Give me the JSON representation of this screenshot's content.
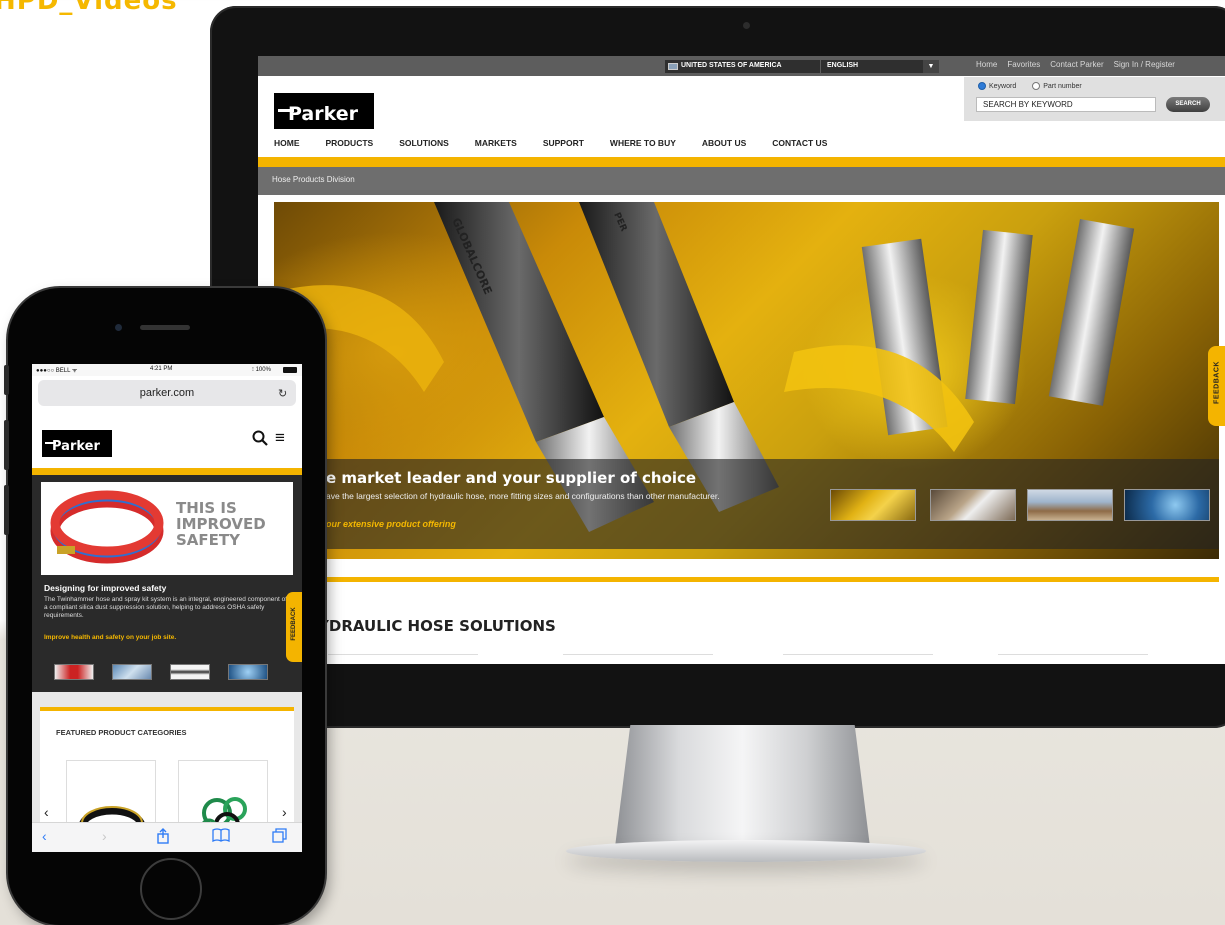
{
  "corner_title": "HPD_Videos",
  "desktop": {
    "country": "UNITED STATES OF AMERICA",
    "language": "ENGLISH",
    "top_links": [
      "Home",
      "Favorites",
      "Contact Parker",
      "Sign In / Register"
    ],
    "search": {
      "option_keyword": "Keyword",
      "option_part": "Part number",
      "value": "SEARCH BY KEYWORD",
      "button": "SEARCH"
    },
    "logo": "Parker",
    "nav": [
      "HOME",
      "PRODUCTS",
      "SOLUTIONS",
      "MARKETS",
      "SUPPORT",
      "WHERE TO BUY",
      "ABOUT US",
      "CONTACT US"
    ],
    "breadcrumb": "Hose Products Division",
    "hero": {
      "heading": "e market leader and your supplier of choice",
      "text": "ave the largest selection of hydraulic hose, more fitting sizes and configurations than other manufacturer.",
      "link": "our extensive product offering",
      "hose_label_1": "GLOBALCORE",
      "hose_label_2": "PER"
    },
    "feedback": "FEEDBACK",
    "section_title": "YDRAULIC HOSE SOLUTIONS"
  },
  "phone": {
    "status_left": "●●●○○ BELL ᯤ",
    "status_time": "4:21 PM",
    "status_right": "⁝ 100%",
    "url": "parker.com",
    "logo": "Parker",
    "banner_title_1": "THIS IS",
    "banner_title_2": "IMPROVED",
    "banner_title_3": "SAFETY",
    "heading": "Designing for improved safety",
    "text": "The Twinhammer hose and spray kit system is an integral, engineered component of a compliant silica dust suppression solution, helping to address OSHA safety requirements.",
    "link": "Improve health and safety on your job site.",
    "feedback": "FEEDBACK",
    "featured": "FEATURED PRODUCT CATEGORIES"
  },
  "colors": {
    "accent": "#f4b400",
    "dark": "#121212"
  }
}
